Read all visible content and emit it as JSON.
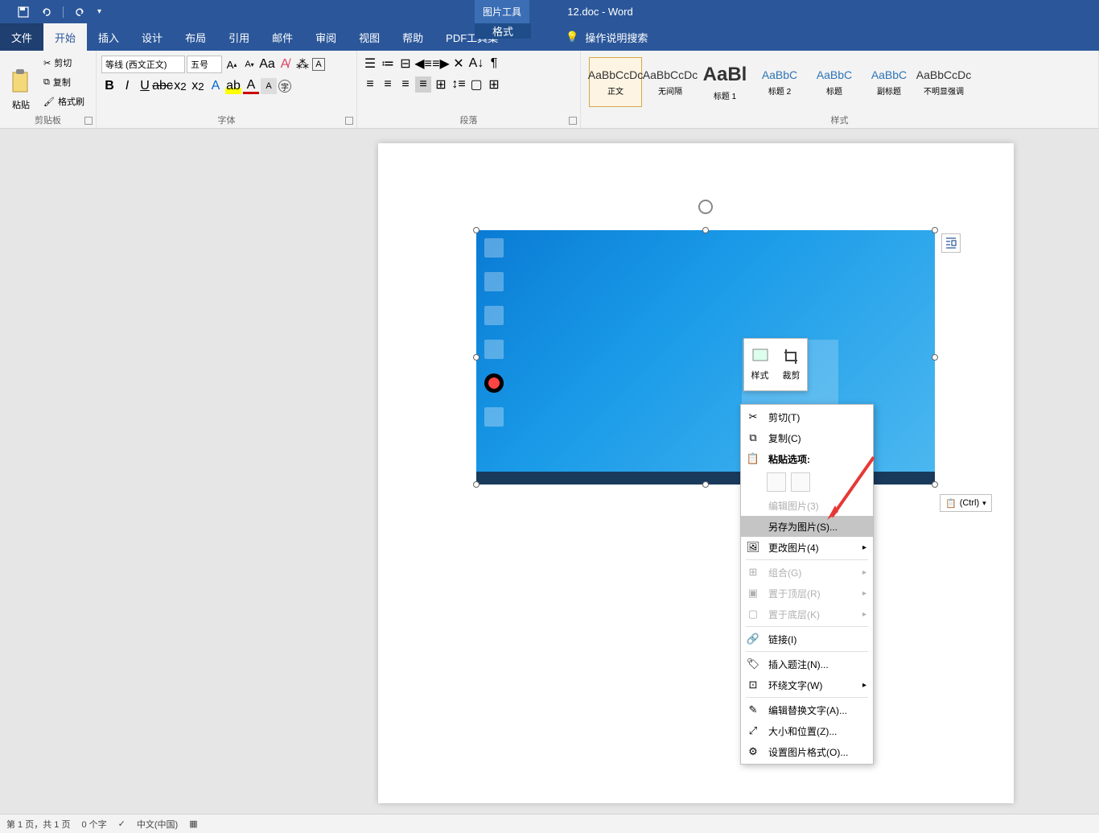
{
  "title": "12.doc  -  Word",
  "pic_tools": "图片工具",
  "qat": {
    "save": "save-icon",
    "undo": "undo-icon",
    "redo": "redo-icon"
  },
  "tabs": {
    "file": "文件",
    "home": "开始",
    "insert": "插入",
    "design": "设计",
    "layout": "布局",
    "references": "引用",
    "mailings": "邮件",
    "review": "审阅",
    "view": "视图",
    "help": "帮助",
    "pdf": "PDF工具集",
    "format": "格式"
  },
  "tellme": "操作说明搜索",
  "ribbon": {
    "clipboard": {
      "label": "剪贴板",
      "paste": "粘贴",
      "cut": "剪切",
      "copy": "复制",
      "format_painter": "格式刷"
    },
    "font": {
      "label": "字体",
      "name": "等线 (西文正文)",
      "size": "五号"
    },
    "paragraph": {
      "label": "段落"
    },
    "styles": {
      "label": "样式",
      "items": [
        {
          "preview": "AaBbCcDc",
          "name": "正文",
          "selected": true
        },
        {
          "preview": "AaBbCcDc",
          "name": "无间隔"
        },
        {
          "preview": "AaBl",
          "name": "标题 1",
          "big": true
        },
        {
          "preview": "AaBbC",
          "name": "标题 2",
          "blue": true
        },
        {
          "preview": "AaBbC",
          "name": "标题",
          "blue": true
        },
        {
          "preview": "AaBbC",
          "name": "副标题",
          "blue": true
        },
        {
          "preview": "AaBbCcDc",
          "name": "不明显强调"
        }
      ]
    }
  },
  "minitoolbar": {
    "style": "样式",
    "crop": "裁剪"
  },
  "context_menu": {
    "cut": "剪切(T)",
    "copy": "复制(C)",
    "paste_label": "粘贴选项:",
    "edit_pic": "编辑图片(3)",
    "save_as_pic": "另存为图片(S)...",
    "change_pic": "更改图片(4)",
    "group": "组合(G)",
    "bring_front": "置于顶层(R)",
    "send_back": "置于底层(K)",
    "link": "链接(I)",
    "insert_caption": "插入题注(N)...",
    "wrap_text": "环绕文字(W)",
    "edit_alt": "编辑替换文字(A)...",
    "size_pos": "大小和位置(Z)...",
    "format_pic": "设置图片格式(O)..."
  },
  "paste_smart": "(Ctrl)",
  "statusbar": {
    "page": "第 1 页，共 1 页",
    "words": "0 个字",
    "lang": "中文(中国)"
  }
}
